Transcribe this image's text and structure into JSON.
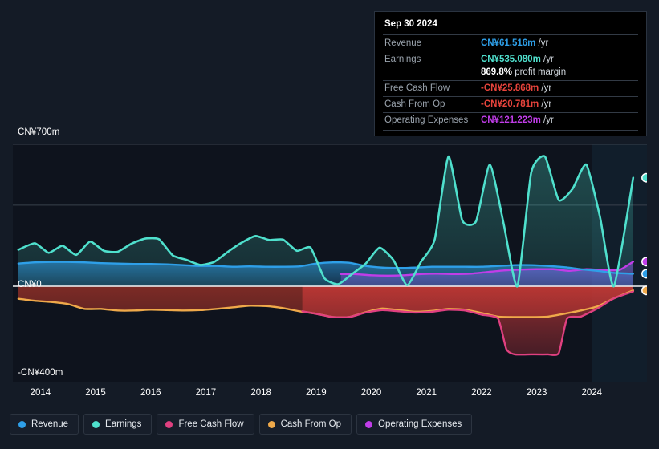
{
  "chart_data": {
    "type": "area",
    "title": "",
    "xlabel": "",
    "ylabel": "",
    "currency": "CN¥",
    "grid": true,
    "legend_position": "bottom",
    "xlim": [
      2013.5,
      2025.0
    ],
    "ylim": [
      -400,
      700
    ],
    "x_tick_labels": [
      "2014",
      "2015",
      "2016",
      "2017",
      "2018",
      "2019",
      "2020",
      "2021",
      "2022",
      "2023",
      "2024"
    ],
    "x_ticks": [
      2014,
      2015,
      2016,
      2017,
      2018,
      2019,
      2020,
      2021,
      2022,
      2023,
      2024
    ],
    "y_tick_labels": [
      "CN¥700m",
      "CN¥0",
      "-CN¥400m"
    ],
    "y_ticks": [
      700,
      0,
      -400
    ],
    "gridlines": [
      700,
      400,
      0
    ],
    "zero_line": 0,
    "forecast_start": 2024.0,
    "series": [
      {
        "name": "Revenue",
        "color": "#2e9fe8",
        "x": [
          2013.6,
          2013.9,
          2014.2,
          2014.5,
          2014.8,
          2015.1,
          2015.4,
          2015.7,
          2016.0,
          2016.3,
          2016.6,
          2016.9,
          2017.2,
          2017.5,
          2017.8,
          2018.1,
          2018.4,
          2018.7,
          2019.0,
          2019.3,
          2019.6,
          2019.9,
          2020.2,
          2020.5,
          2020.8,
          2021.1,
          2021.4,
          2021.7,
          2022.0,
          2022.3,
          2022.6,
          2022.9,
          2023.2,
          2023.5,
          2023.8,
          2024.1,
          2024.4,
          2024.75
        ],
        "values": [
          112,
          118,
          120,
          120,
          118,
          114,
          112,
          110,
          110,
          108,
          104,
          100,
          100,
          96,
          98,
          96,
          96,
          98,
          112,
          118,
          116,
          100,
          92,
          90,
          92,
          96,
          96,
          96,
          96,
          100,
          104,
          104,
          100,
          94,
          84,
          76,
          66,
          61.5
        ]
      },
      {
        "name": "Earnings",
        "color": "#4fe0cd",
        "x": [
          2013.6,
          2013.9,
          2014.15,
          2014.4,
          2014.65,
          2014.9,
          2015.15,
          2015.4,
          2015.65,
          2015.9,
          2016.15,
          2016.4,
          2016.65,
          2016.9,
          2017.15,
          2017.4,
          2017.65,
          2017.9,
          2018.15,
          2018.4,
          2018.65,
          2018.9,
          2019.15,
          2019.4,
          2019.65,
          2019.9,
          2020.15,
          2020.4,
          2020.65,
          2020.9,
          2021.15,
          2021.4,
          2021.65,
          2021.9,
          2022.15,
          2022.4,
          2022.65,
          2022.9,
          2023.15,
          2023.4,
          2023.65,
          2023.9,
          2024.15,
          2024.4,
          2024.75
        ],
        "values": [
          180,
          212,
          165,
          200,
          155,
          220,
          175,
          170,
          210,
          235,
          232,
          152,
          130,
          105,
          120,
          170,
          215,
          248,
          228,
          230,
          175,
          190,
          40,
          10,
          60,
          112,
          190,
          130,
          5,
          120,
          230,
          640,
          325,
          320,
          600,
          310,
          0,
          560,
          640,
          425,
          480,
          600,
          340,
          0,
          535.08
        ]
      },
      {
        "name": "Free Cash Flow",
        "color": "#e04080",
        "x": [
          2018.75,
          2019.0,
          2019.3,
          2019.6,
          2019.9,
          2020.2,
          2020.5,
          2020.8,
          2021.1,
          2021.4,
          2021.7,
          2022.0,
          2022.3,
          2022.45,
          2022.6,
          2022.9,
          2023.2,
          2023.4,
          2023.55,
          2023.8,
          2024.1,
          2024.4,
          2024.75
        ],
        "values": [
          -124,
          -136,
          -152,
          -152,
          -130,
          -118,
          -124,
          -130,
          -126,
          -116,
          -120,
          -140,
          -160,
          -310,
          -336,
          -336,
          -336,
          -330,
          -160,
          -150,
          -110,
          -60,
          -25.868
        ]
      },
      {
        "name": "Cash From Op",
        "color": "#efa94a",
        "x": [
          2013.6,
          2013.9,
          2014.2,
          2014.5,
          2014.8,
          2015.1,
          2015.4,
          2015.7,
          2016.0,
          2016.3,
          2016.6,
          2016.9,
          2017.2,
          2017.5,
          2017.8,
          2018.1,
          2018.4,
          2018.7,
          2019.0,
          2019.3,
          2019.6,
          2019.9,
          2020.2,
          2020.5,
          2020.8,
          2021.1,
          2021.4,
          2021.7,
          2022.0,
          2022.3,
          2022.6,
          2022.9,
          2023.2,
          2023.5,
          2023.8,
          2024.1,
          2024.4,
          2024.75
        ],
        "values": [
          -62,
          -72,
          -78,
          -88,
          -112,
          -112,
          -120,
          -120,
          -116,
          -118,
          -120,
          -118,
          -112,
          -104,
          -96,
          -98,
          -108,
          -124,
          -136,
          -152,
          -152,
          -128,
          -110,
          -118,
          -126,
          -122,
          -112,
          -116,
          -132,
          -150,
          -152,
          -152,
          -150,
          -136,
          -120,
          -100,
          -60,
          -20.781
        ]
      },
      {
        "name": "Operating Expenses",
        "color": "#c03de8",
        "x": [
          2019.45,
          2019.7,
          2020.0,
          2020.3,
          2020.6,
          2020.9,
          2021.2,
          2021.5,
          2021.8,
          2022.1,
          2022.4,
          2022.7,
          2023.0,
          2023.3,
          2023.6,
          2023.9,
          2024.2,
          2024.5,
          2024.75
        ],
        "values": [
          60,
          60,
          54,
          52,
          54,
          60,
          62,
          60,
          62,
          70,
          78,
          82,
          84,
          84,
          76,
          84,
          80,
          80,
          121.223
        ]
      }
    ],
    "endpoints": [
      {
        "name": "Earnings",
        "value": 535.08,
        "color": "#4fe0cd"
      },
      {
        "name": "Operating Expenses",
        "value": 121.223,
        "color": "#c03de8"
      },
      {
        "name": "Revenue",
        "value": 61.516,
        "color": "#2e9fe8"
      },
      {
        "name": "Cash From Op",
        "value": -20.781,
        "color": "#efa94a"
      }
    ]
  },
  "tooltip": {
    "date": "Sep 30 2024",
    "rows": [
      {
        "label": "Revenue",
        "amount": "CN¥61.516m",
        "unit": "/yr",
        "color": "#2e9fe8"
      },
      {
        "label": "Earnings",
        "amount": "CN¥535.080m",
        "unit": "/yr",
        "color": "#4fe0cd"
      },
      {
        "label": "Free Cash Flow",
        "amount": "-CN¥25.868m",
        "unit": "/yr",
        "color": "#e8443c"
      },
      {
        "label": "Cash From Op",
        "amount": "-CN¥20.781m",
        "unit": "/yr",
        "color": "#e8443c"
      },
      {
        "label": "Operating Expenses",
        "amount": "CN¥121.223m",
        "unit": "/yr",
        "color": "#c03de8"
      }
    ],
    "profit_margin_value": "869.8%",
    "profit_margin_text": "profit margin"
  },
  "legend": {
    "items": [
      {
        "label": "Revenue",
        "color": "#2e9fe8"
      },
      {
        "label": "Earnings",
        "color": "#4fe0cd"
      },
      {
        "label": "Free Cash Flow",
        "color": "#e04080"
      },
      {
        "label": "Cash From Op",
        "color": "#efa94a"
      },
      {
        "label": "Operating Expenses",
        "color": "#c03de8"
      }
    ]
  }
}
